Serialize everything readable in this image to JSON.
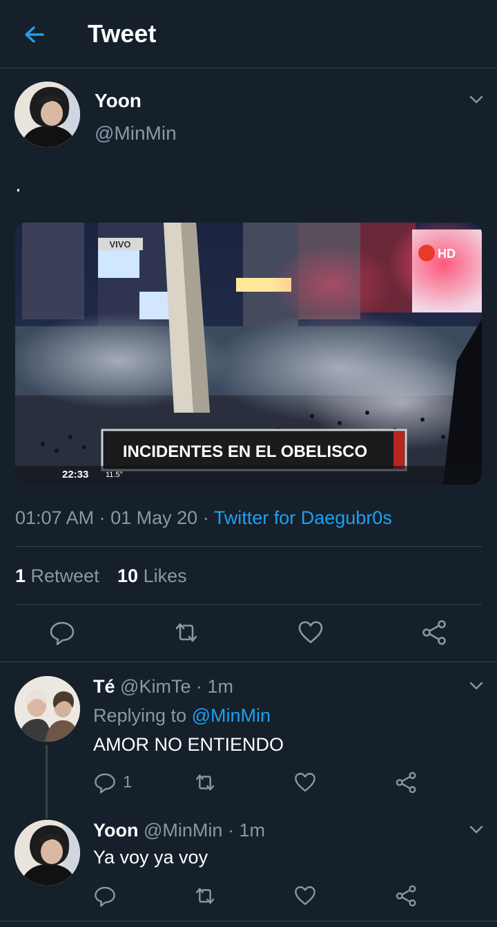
{
  "header": {
    "title": "Tweet",
    "back_icon": "arrow-left-icon"
  },
  "tweet": {
    "author_name": "Yoon",
    "author_handle": "@MinMin",
    "text": ".",
    "media": {
      "overlay_banner": "INCIDENTES EN EL OBELISCO",
      "corner_label": "VIVO",
      "channel_logo": "HD",
      "clock": "22:33",
      "temperature": "11.5°"
    },
    "time": "01:07 AM",
    "date": "01 May 20",
    "separator": "·",
    "source": "Twitter for Daegubr0s",
    "retweets_count": "1",
    "retweets_label": "Retweet",
    "likes_count": "10",
    "likes_label": "Likes"
  },
  "replies": [
    {
      "name": "Té",
      "handle": "@KimTe",
      "time": "· 1m",
      "replying_prefix": "Replying to",
      "replying_to": "@MinMin",
      "text": "AMOR NO ENTIENDO",
      "reply_count": "1"
    },
    {
      "name": "Yoon",
      "handle": "@MinMin",
      "time": "· 1m",
      "text": "Ya voy ya voy"
    }
  ],
  "colors": {
    "background": "#15202b",
    "accent": "#1da1f2",
    "muted": "#8899a6",
    "divider": "#38444d"
  }
}
